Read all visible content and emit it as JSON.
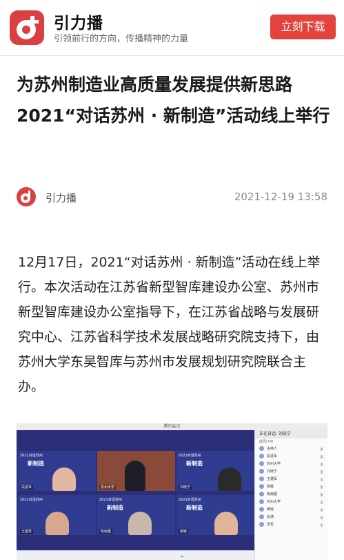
{
  "header": {
    "app_name": "引力播",
    "slogan": "引领前行的方向，传播精神的力量",
    "download_label": "立刻下载",
    "brand_color": "#e3423d"
  },
  "article": {
    "title": "为苏州制造业高质量发展提供新思路2021“对话苏州 · 新制造”活动线上举行",
    "source_name": "引力播",
    "published": "2021-12-19 13:58",
    "body": "12月17日，2021“对话苏州 · 新制造”活动在线上举行。本次活动在江苏省新型智库建设办公室、苏州市新型智库建设办公室指导下，在江苏省战略与发展研究中心、江苏省科学技术发展战略研究院支持下，由苏州大学东吴智库与苏州市发展规划研究院联合主办。"
  },
  "screenshot": {
    "window_title": "腾讯会议",
    "tile_label": "2021对话苏州",
    "tile_logo": "新制造",
    "tiles": [
      {
        "name": "段进军"
      },
      {
        "name": "苏州大学"
      },
      {
        "name": "刘晓宁"
      },
      {
        "name": "王建军"
      },
      {
        "name": "陈雨露"
      },
      {
        "name": "张敏"
      }
    ],
    "panel_title": "正在讲话: 刘晓宁",
    "panel_sub": "成员(74)",
    "participants": [
      "主持人",
      "段进军",
      "苏州大学",
      "刘晓宁",
      "王建军",
      "张敏",
      "陈雨露",
      "苏州大学",
      "吴晓",
      "张涛",
      "李军"
    ]
  },
  "icons": [
    "logo-icon",
    "chevron-down-icon",
    "mic-icon"
  ]
}
